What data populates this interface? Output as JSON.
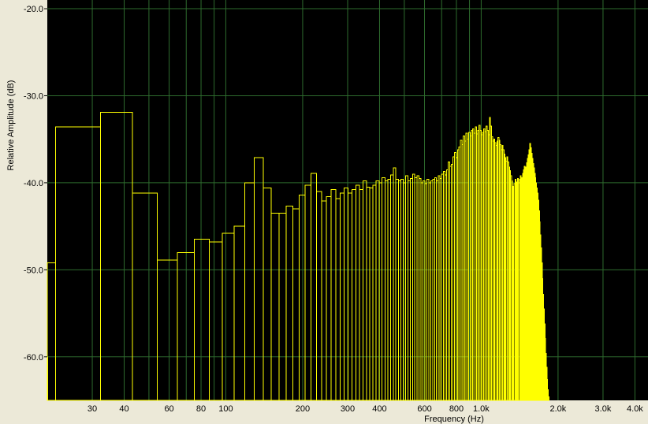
{
  "chart_data": {
    "type": "bar",
    "ylabel": "Relative Amplitude (dB)",
    "xlabel": "Frequency (Hz)",
    "xscale": "log",
    "xlim": [
      20,
      4500
    ],
    "ylim": [
      -65,
      -19
    ],
    "grid": true,
    "colors": {
      "background": "#000000",
      "grid": "#2e6b2e",
      "bars": "#ffff00",
      "frame": "#ece9d8"
    },
    "yticks": [
      {
        "value": -20,
        "label": "-20.0"
      },
      {
        "value": -30,
        "label": "-30.0"
      },
      {
        "value": -40,
        "label": "-40.0"
      },
      {
        "value": -50,
        "label": "-50.0"
      },
      {
        "value": -60,
        "label": "-60.0"
      }
    ],
    "xticks": [
      {
        "value": 30,
        "label": "30"
      },
      {
        "value": 40,
        "label": "40"
      },
      {
        "value": 60,
        "label": "60"
      },
      {
        "value": 80,
        "label": "80"
      },
      {
        "value": 100,
        "label": "100"
      },
      {
        "value": 200,
        "label": "200"
      },
      {
        "value": 300,
        "label": "300"
      },
      {
        "value": 400,
        "label": "400"
      },
      {
        "value": 600,
        "label": "600"
      },
      {
        "value": 800,
        "label": "800"
      },
      {
        "value": 1000,
        "label": "1.0k"
      },
      {
        "value": 2000,
        "label": "2.0k"
      },
      {
        "value": 3000,
        "label": "3.0k"
      },
      {
        "value": 4000,
        "label": "4.0k"
      }
    ],
    "xgrid": [
      30,
      40,
      50,
      60,
      70,
      80,
      90,
      100,
      200,
      300,
      400,
      500,
      600,
      700,
      800,
      900,
      1000,
      2000,
      3000,
      4000
    ],
    "ygrid": [
      -20,
      -30,
      -40,
      -50,
      -60
    ],
    "bin_width_hz": 10.77,
    "values": [
      -60.0,
      -49.2,
      -33.6,
      -31.9,
      -41.2,
      -48.9,
      -48.0,
      -46.5,
      -46.8,
      -45.8,
      -45.0,
      -40.0,
      -37.1,
      -40.6,
      -43.5,
      -43.5,
      -42.7,
      -43.0,
      -41.4,
      -40.3,
      -38.9,
      -41.0,
      -42.1,
      -41.6,
      -40.8,
      -41.8,
      -41.2,
      -40.6,
      -41.2,
      -40.8,
      -40.3,
      -40.8,
      -39.8,
      -40.5,
      -40.6,
      -40.3,
      -39.8,
      -40.0,
      -39.4,
      -39.8,
      -39.6,
      -39.1,
      -38.3,
      -39.6,
      -39.8,
      -39.6,
      -40.0,
      -39.2,
      -39.8,
      -39.5,
      -39.0,
      -39.4,
      -39.2,
      -39.5,
      -40.0,
      -39.8,
      -40.1,
      -39.6,
      -40.0,
      -39.8,
      -39.6,
      -39.4,
      -39.8,
      -39.2,
      -39.5,
      -39.0,
      -38.7,
      -39.1,
      -38.5,
      -37.6,
      -38.1,
      -37.9,
      -37.0,
      -36.5,
      -37.1,
      -36.2,
      -35.9,
      -35.1,
      -35.6,
      -34.6,
      -35.2,
      -34.3,
      -35.0,
      -34.2,
      -34.6,
      -34.0,
      -33.8,
      -34.3,
      -33.6,
      -34.4,
      -34.0,
      -33.4,
      -34.0,
      -34.5,
      -34.2,
      -33.8,
      -34.1,
      -33.5,
      -34.0,
      -34.5,
      -32.5,
      -33.5,
      -34.7,
      -35.2,
      -35.0,
      -35.4,
      -35.7,
      -35.2,
      -34.8,
      -35.1,
      -35.6,
      -36.2,
      -35.7,
      -36.2,
      -36.7,
      -37.1,
      -37.5,
      -37.0,
      -37.6,
      -38.2,
      -38.6,
      -39.2,
      -39.8,
      -40.4,
      -40.9,
      -40.1,
      -39.6,
      -40.3,
      -39.9,
      -39.5,
      -40.0,
      -39.6,
      -39.2,
      -39.8,
      -39.4,
      -38.9,
      -38.5,
      -38.1,
      -38.7,
      -38.2,
      -37.7,
      -37.2,
      -36.8,
      -36.2,
      -35.5,
      -36.0,
      -36.6,
      -37.2,
      -37.8,
      -38.3,
      -38.9,
      -39.4,
      -40.0,
      -40.6,
      -41.2,
      -42.0,
      -43.2,
      -44.5,
      -46.0,
      -47.5,
      -49.2,
      -51.0,
      -52.8,
      -54.5,
      -56.2,
      -57.9,
      -59.6,
      -61.2,
      -62.6,
      -63.8,
      -64.6
    ]
  }
}
